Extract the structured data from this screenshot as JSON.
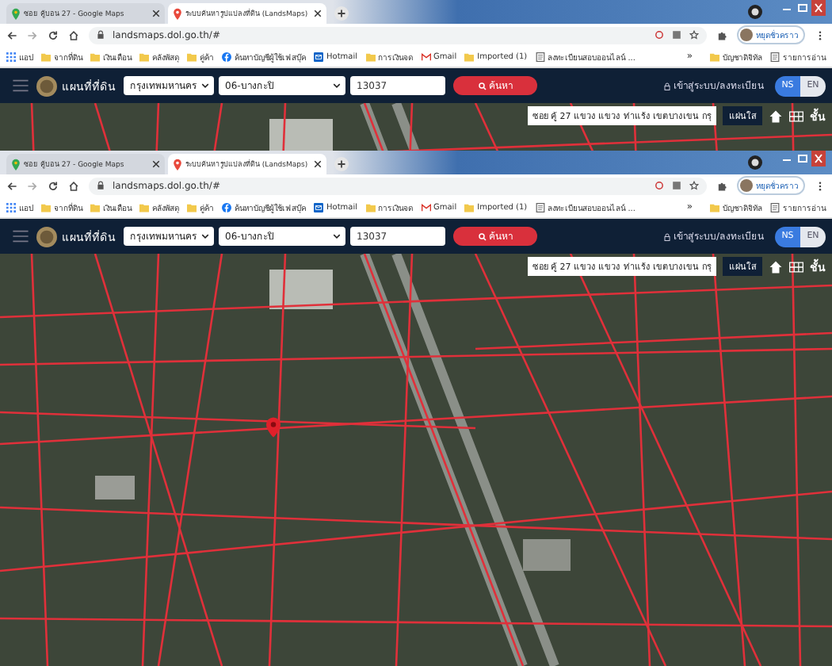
{
  "windows": [
    {
      "kind": "background",
      "tabs": [
        {
          "title": "ซอย คู้บอน 27 - Google Maps",
          "selected": false
        },
        {
          "title": "ระบบค้นหารูปแปลงที่ดิน (LandsMaps)",
          "selected": true
        }
      ],
      "url": "landsmaps.dol.go.th/#",
      "profile": "หยุดชั่วคราว",
      "bookmarks": [
        {
          "label": "แอป",
          "kind": "apps"
        },
        {
          "label": "จากที่ดิน",
          "kind": "folder"
        },
        {
          "label": "เงินเดือน",
          "kind": "folder"
        },
        {
          "label": "คลังพัสดุ",
          "kind": "folder"
        },
        {
          "label": "คู่ค้า",
          "kind": "folder"
        },
        {
          "label": "ค้นหาบัญชีผู้ใช้เฟสบุ๊ค",
          "kind": "facebook"
        },
        {
          "label": "Hotmail",
          "kind": "hotmail"
        },
        {
          "label": "การเงินจด",
          "kind": "folder"
        },
        {
          "label": "Gmail",
          "kind": "gmail"
        },
        {
          "label": "Imported (1)",
          "kind": "folder"
        },
        {
          "label": "ลงทะเบียนสอบออนไลน์ ...",
          "kind": "page"
        }
      ],
      "more": "»",
      "extra_bookmarks": [
        {
          "label": "บัญชาดิจิทัล",
          "kind": "folder"
        },
        {
          "label": "รายการอ่าน",
          "kind": "page"
        }
      ],
      "site": {
        "title": "แผนที่ที่ดิน",
        "province": "กรุงเทพมหานคร",
        "district": "06-บางกะปิ",
        "parcel": "13037",
        "search_button": "ค้นหา",
        "login": "เข้าสู่ระบบ/ลงทะเบียน",
        "languages": [
          {
            "label": "NS",
            "selected": true
          },
          {
            "label": "EN",
            "selected": false
          }
        ]
      },
      "map": {
        "address": "ซอย คู้ 27 แขวง แขวง ท่าแร้ง เขตบางเขน กรุ",
        "overlay_button": "แผ่นใส",
        "layers_button": "ชั้น"
      }
    },
    {
      "kind": "front",
      "tabs": [
        {
          "title": "ซอย คู้บอน 27 - Google Maps",
          "selected": false
        },
        {
          "title": "ระบบค้นหารูปแปลงที่ดิน (LandsMaps)",
          "selected": true
        }
      ],
      "url": "landsmaps.dol.go.th/#",
      "profile": "หยุดชั่วคราว",
      "bookmarks": [
        {
          "label": "แอป",
          "kind": "apps"
        },
        {
          "label": "จากที่ดิน",
          "kind": "folder"
        },
        {
          "label": "เงินเดือน",
          "kind": "folder"
        },
        {
          "label": "คลังพัสดุ",
          "kind": "folder"
        },
        {
          "label": "คู่ค้า",
          "kind": "folder"
        },
        {
          "label": "ค้นหาบัญชีผู้ใช้เฟสบุ๊ค",
          "kind": "facebook"
        },
        {
          "label": "Hotmail",
          "kind": "hotmail"
        },
        {
          "label": "การเงินจด",
          "kind": "folder"
        },
        {
          "label": "Gmail",
          "kind": "gmail"
        },
        {
          "label": "Imported (1)",
          "kind": "folder"
        },
        {
          "label": "ลงทะเบียนสอบออนไลน์ ...",
          "kind": "page"
        }
      ],
      "more": "»",
      "extra_bookmarks": [
        {
          "label": "บัญชาดิจิทัล",
          "kind": "folder"
        },
        {
          "label": "รายการอ่าน",
          "kind": "page"
        }
      ],
      "site": {
        "title": "แผนที่ที่ดิน",
        "province": "กรุงเทพมหานคร",
        "district": "06-บางกะปิ",
        "parcel": "13037",
        "search_button": "ค้นหา",
        "login": "เข้าสู่ระบบ/ลงทะเบียน",
        "languages": [
          {
            "label": "NS",
            "selected": true
          },
          {
            "label": "EN",
            "selected": false
          }
        ]
      },
      "map": {
        "address": "ซอย คู้ 27 แขวง แขวง ท่าแร้ง เขตบางเขน กรุ",
        "overlay_button": "แผ่นใส",
        "layers_button": "ชั้น"
      }
    }
  ]
}
